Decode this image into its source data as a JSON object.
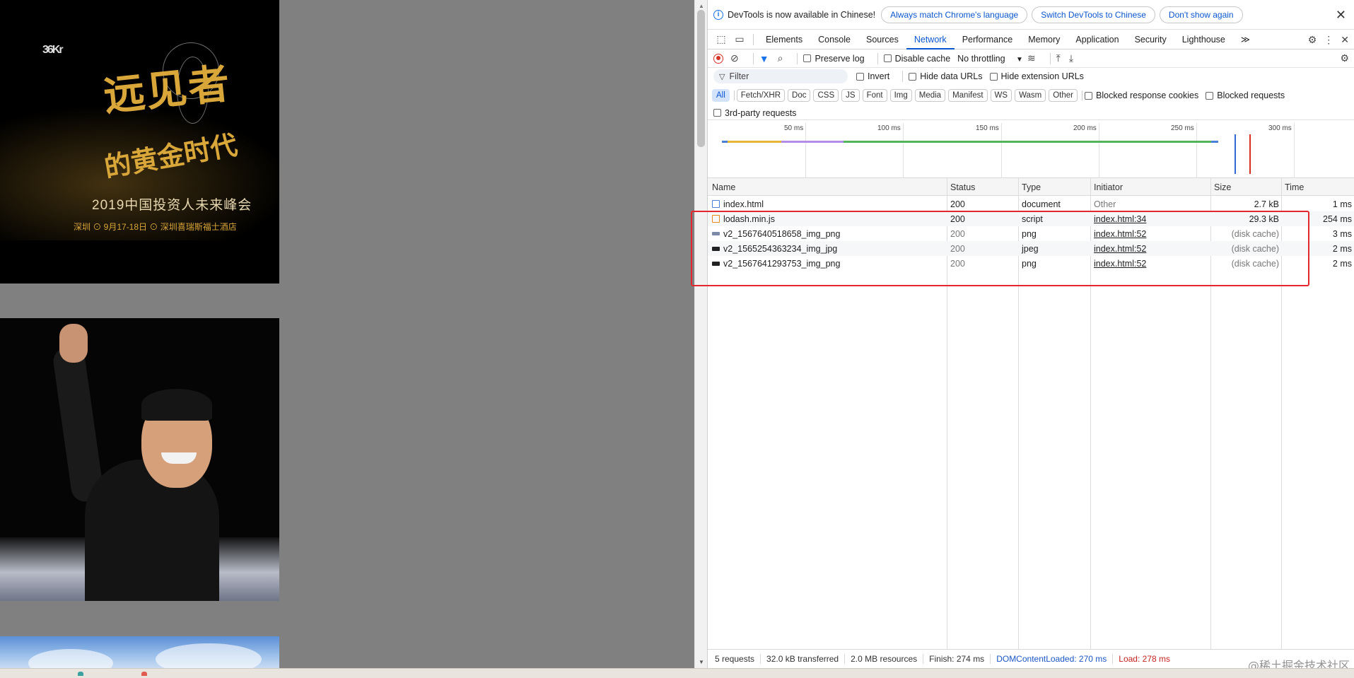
{
  "devtools": {
    "infobar": {
      "message": "DevTools is now available in Chinese!",
      "btn_match": "Always match Chrome's language",
      "btn_switch": "Switch DevTools to Chinese",
      "btn_dont_show": "Don't show again",
      "close": "✕"
    },
    "tabs": [
      "Elements",
      "Console",
      "Sources",
      "Network",
      "Performance",
      "Memory",
      "Application",
      "Security",
      "Lighthouse"
    ],
    "active_tab": "Network",
    "more_tabs": "≫",
    "toolbar": {
      "preserve_log": "Preserve log",
      "disable_cache": "Disable cache",
      "throttling": "No throttling"
    },
    "filter": {
      "placeholder": "Filter",
      "invert": "Invert",
      "hide_data_urls": "Hide data URLs",
      "hide_extension_urls": "Hide extension URLs"
    },
    "type_filters": [
      "All",
      "Fetch/XHR",
      "Doc",
      "CSS",
      "JS",
      "Font",
      "Img",
      "Media",
      "Manifest",
      "WS",
      "Wasm",
      "Other"
    ],
    "blocked_response_cookies": "Blocked response cookies",
    "blocked_requests": "Blocked requests",
    "third_party": "3rd-party requests",
    "overview_ticks": [
      "50 ms",
      "100 ms",
      "150 ms",
      "200 ms",
      "250 ms",
      "300 ms"
    ],
    "columns": {
      "name": "Name",
      "status": "Status",
      "type": "Type",
      "initiator": "Initiator",
      "size": "Size",
      "time": "Time"
    },
    "requests": [
      {
        "name": "index.html",
        "status": "200",
        "type": "document",
        "initiator": "Other",
        "size": "2.7 kB",
        "time": "1 ms",
        "icon_color": "#4a7fd8"
      },
      {
        "name": "lodash.min.js",
        "status": "200",
        "type": "script",
        "initiator": "index.html:34",
        "size": "29.3 kB",
        "time": "254 ms",
        "icon_color": "#e8891a"
      },
      {
        "name": "v2_1567640518658_img_png",
        "status": "200",
        "type": "png",
        "initiator": "index.html:52",
        "size": "(disk cache)",
        "time": "3 ms",
        "icon_color": "#7a8aa8"
      },
      {
        "name": "v2_1565254363234_img_jpg",
        "status": "200",
        "type": "jpeg",
        "initiator": "index.html:52",
        "size": "(disk cache)",
        "time": "2 ms",
        "icon_color": "#222222"
      },
      {
        "name": "v2_1567641293753_img_png",
        "status": "200",
        "type": "png",
        "initiator": "index.html:52",
        "size": "(disk cache)",
        "time": "2 ms",
        "icon_color": "#222222"
      }
    ],
    "statusbar": {
      "requests": "5 requests",
      "transferred": "32.0 kB transferred",
      "resources": "2.0 MB resources",
      "finish": "Finish: 274 ms",
      "dcl": "DOMContentLoaded: 270 ms",
      "load": "Load: 278 ms"
    }
  },
  "page": {
    "poster": {
      "logo": "36Kr",
      "title_line1": "远见者",
      "title_line2": "的黄金时代",
      "event": "2019中国投资人未来峰会",
      "details": "深圳  ⊙ 9月17-18日  ⊙ 深圳喜瑞斯福士酒店"
    }
  },
  "watermark": "@稀土掘金技术社区",
  "colors": {
    "accent": "#0b57d0",
    "highlight_box": "#e3272d",
    "error": "#c5221f"
  }
}
